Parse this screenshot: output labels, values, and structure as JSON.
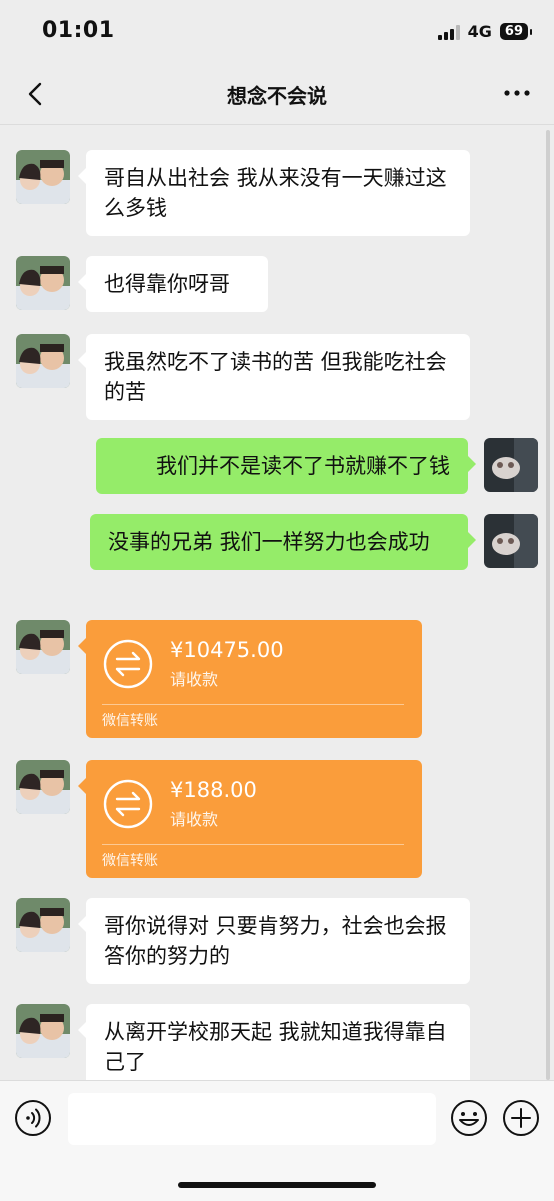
{
  "status_bar": {
    "time": "01:01",
    "network": "4G",
    "battery": "69"
  },
  "header": {
    "title": "想念不会说",
    "back_icon": "chevron-left-icon",
    "more_icon": "more-dots-icon"
  },
  "messages": [
    {
      "side": "left",
      "type": "text",
      "text": "哥自从出社会 我从来没有一天赚过这么多钱"
    },
    {
      "side": "left",
      "type": "text",
      "text": "也得靠你呀哥"
    },
    {
      "side": "left",
      "type": "text",
      "text": "我虽然吃不了读书的苦 但我能吃社会的苦"
    },
    {
      "side": "right",
      "type": "text",
      "text": "我们并不是读不了书就赚不了钱"
    },
    {
      "side": "right",
      "type": "text",
      "text": "没事的兄弟 我们一样努力也会成功"
    },
    {
      "side": "left",
      "type": "transfer",
      "amount": "¥10475.00",
      "note": "请收款",
      "label": "微信转账"
    },
    {
      "side": "left",
      "type": "transfer",
      "amount": "¥188.00",
      "note": "请收款",
      "label": "微信转账"
    },
    {
      "side": "left",
      "type": "text",
      "text": "哥你说得对 只要肯努力，社会也会报答你的努力的"
    },
    {
      "side": "left",
      "type": "text",
      "text": "从离开学校那天起 我就知道我得靠自己了"
    }
  ],
  "input_bar": {
    "placeholder": "",
    "voice_icon": "voice-icon",
    "emoji_icon": "emoji-icon",
    "plus_icon": "plus-icon"
  },
  "colors": {
    "background": "#ededed",
    "bubble_self": "#95ec69",
    "bubble_other": "#ffffff",
    "transfer": "#fa9d3b"
  }
}
